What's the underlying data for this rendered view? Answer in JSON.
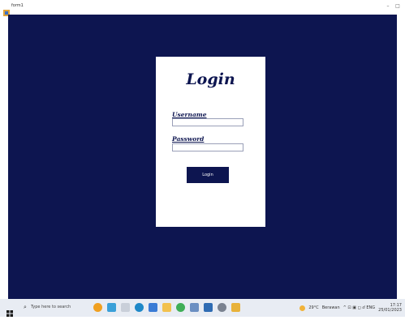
{
  "window": {
    "title": "form1",
    "minimize_glyph": "–",
    "maximize_glyph": "□"
  },
  "login": {
    "heading": "Login",
    "username_label": "Username",
    "username_value": "",
    "password_label": "Password",
    "password_value": "",
    "button_label": "Login"
  },
  "taskbar": {
    "search_placeholder": "Type here to search",
    "weather": "29°C",
    "weather_desc": "Berawan",
    "time": "17:17",
    "date": "25/01/2023",
    "tray_glyphs": "^ ⊡ ▣ ◻ ⅆ ENG"
  },
  "colors": {
    "app_background": "#0d1550",
    "card_background": "#ffffff",
    "accent": "#0d1550"
  }
}
